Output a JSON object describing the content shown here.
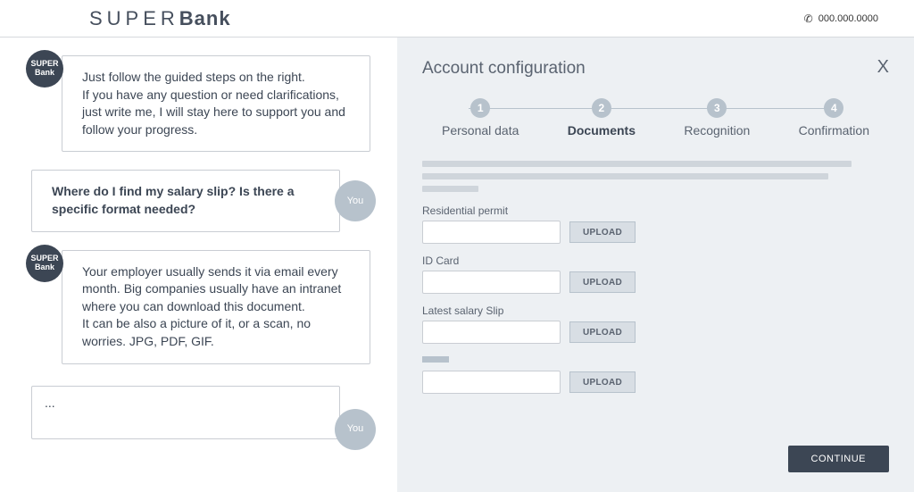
{
  "header": {
    "logo_thin": "SUPER",
    "logo_bold": "Bank",
    "phone": "000.000.0000"
  },
  "chat": {
    "bot_avatar_line1": "SUPER",
    "bot_avatar_line2": "Bank",
    "user_avatar": "You",
    "messages": [
      {
        "from": "bot",
        "text": "Just follow the guided steps on the right.\nIf you have any question or need clarifications, just write me, I will stay here to support you and follow your progress."
      },
      {
        "from": "user",
        "text": "Where do I find my salary slip? Is there a specific format needed?"
      },
      {
        "from": "bot",
        "text": "Your employer usually sends it via email every month. Big companies usually have an intranet where you can download this document.\nIt can be also a picture of it, or a scan, no worries. JPG, PDF, GIF."
      }
    ],
    "input_value": "..."
  },
  "panel": {
    "title": "Account configuration",
    "close_label": "X",
    "steps": [
      {
        "num": "1",
        "label": "Personal data"
      },
      {
        "num": "2",
        "label": "Documents"
      },
      {
        "num": "3",
        "label": "Recognition"
      },
      {
        "num": "4",
        "label": "Confirmation"
      }
    ],
    "active_step_index": 1,
    "upload_label": "UPLOAD",
    "continue_label": "CONTINUE",
    "fields": [
      {
        "label": "Residential permit"
      },
      {
        "label": "ID Card"
      },
      {
        "label": "Latest salary Slip"
      },
      {
        "label": ""
      }
    ]
  }
}
